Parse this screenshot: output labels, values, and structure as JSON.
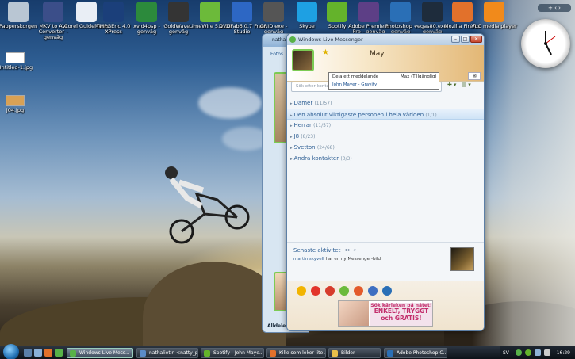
{
  "desktop_icons": [
    {
      "name": "Papperskorgen",
      "icon": "recycle-bin-icon",
      "color": "#b9c6d3"
    },
    {
      "name": "MKV to AVI Converter - genväg",
      "icon": "mkv-icon",
      "color": "#3b4e89"
    },
    {
      "name": "Corel GuideMenu",
      "icon": "corel-icon",
      "color": "#e9eef5"
    },
    {
      "name": "TMPGEnc 4.0 XPress",
      "icon": "tmpgenc-icon",
      "color": "#1b3f7a"
    },
    {
      "name": "xvid4psp - genväg",
      "icon": "xvid-icon",
      "color": "#2c8a3c"
    },
    {
      "name": "GoldWave - genväg",
      "icon": "goldwave-icon",
      "color": "#343434"
    },
    {
      "name": "LimeWire 5.2.13",
      "icon": "limewire-icon",
      "color": "#6cba3a"
    },
    {
      "name": "DVDFab6.0.7 Free Studio",
      "icon": "dvdfab-icon",
      "color": "#2d67c4"
    },
    {
      "name": "GRID.exe - genväg",
      "icon": "grid-icon",
      "color": "#555"
    },
    {
      "name": "Skype",
      "icon": "skype-icon",
      "color": "#1ea0e3"
    },
    {
      "name": "Spotify",
      "icon": "spotify-icon",
      "color": "#64b32b"
    },
    {
      "name": "Adobe Premiere Pro - genväg",
      "icon": "premiere-icon",
      "color": "#5d3f86"
    },
    {
      "name": "Photoshop - genväg",
      "icon": "photoshop-icon",
      "color": "#2a6fb6"
    },
    {
      "name": "vegas80.exe - genväg",
      "icon": "vegas-icon",
      "color": "#1e2c3c"
    },
    {
      "name": "Mozilla Firefox",
      "icon": "firefox-icon",
      "color": "#e2712b"
    },
    {
      "name": "VLC media player",
      "icon": "vlc-icon",
      "color": "#f18a1b"
    },
    {
      "name": "Untitled-1.jpg",
      "icon": "image-file-icon",
      "color": "#ffffff"
    },
    {
      "name": "j04.jpg",
      "icon": "image-file-icon",
      "color": "#d8a155"
    }
  ],
  "gadgets": {
    "toolbar_label": "+ ‹ ›"
  },
  "back_window": {
    "title": "nathalie",
    "tab": "Fotos",
    "status": "Alldeles"
  },
  "messenger": {
    "title": "Windows Live Messenger",
    "nickname": "May",
    "tooltip_share": "Dela ett meddelande",
    "tooltip_status": "Max (Tillgänglig)",
    "tooltip_music": "John Mayer - Gravity",
    "search_placeholder": "Sök efter kontakter eller på Internet...",
    "groups": [
      {
        "name": "Damer",
        "count": "(11/57)"
      },
      {
        "name": "Den absolut viktigaste personen i hela världen",
        "count": "(1/1)",
        "selected": true
      },
      {
        "name": "Herrar",
        "count": "(11/57)"
      },
      {
        "name": "J8",
        "count": "(8/23)"
      },
      {
        "name": "Svetton",
        "count": "(24/68)"
      },
      {
        "name": "Andra kontakter",
        "count": "(0/3)"
      }
    ],
    "recent_title": "Senaste aktivitet",
    "recent_name": "martin skyvell",
    "recent_text": " har en ny Messenger-bild",
    "ad_line1": "Sök kärleken på nätet!",
    "ad_line2": "ENKELT, TRYGGT",
    "ad_line3": "och GRATIS!"
  },
  "taskbar": {
    "tasks": [
      {
        "label": "Windows Live Mess...",
        "color": "#58b248",
        "active": true
      },
      {
        "label": "nathalietin <natty_p...",
        "color": "#5b8cc8"
      },
      {
        "label": "Spotify - John Maye...",
        "color": "#64b32b"
      },
      {
        "label": "Kille som leker lite ...",
        "color": "#e2712b"
      },
      {
        "label": "Bilder",
        "color": "#e9c04a"
      },
      {
        "label": "Adobe Photoshop C...",
        "color": "#2a6fb6"
      }
    ],
    "lang": "SV",
    "time": "16:29"
  }
}
